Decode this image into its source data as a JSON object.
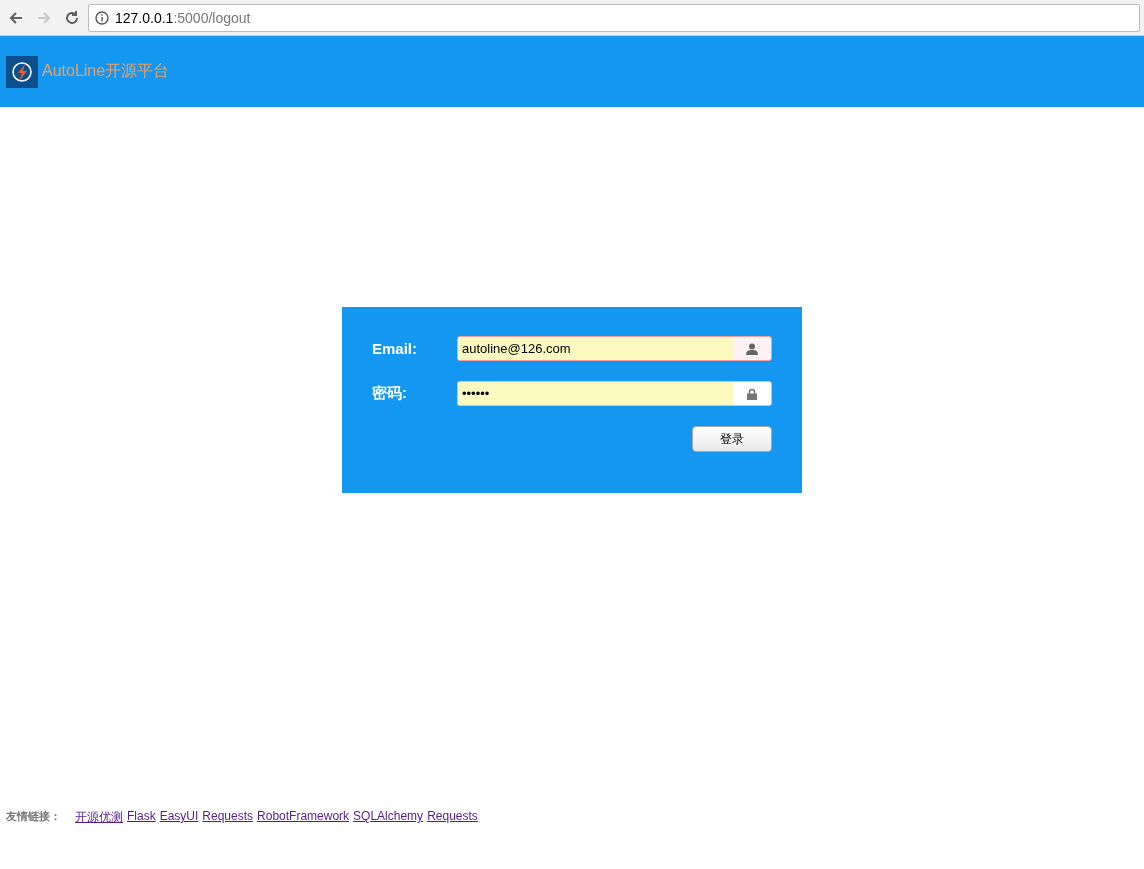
{
  "browser": {
    "nav_buttons": [
      {
        "kind": "back",
        "disabled": false
      },
      {
        "kind": "forward",
        "disabled": true
      },
      {
        "kind": "reload",
        "disabled": false
      }
    ],
    "url_host": "127.0.0.1",
    "url_rest": ":5000/logout"
  },
  "header": {
    "title": "AutoLine开源平台"
  },
  "login": {
    "fields": [
      {
        "label": "Email:",
        "value": "autoline@126.com",
        "kind": "email",
        "invalid": true
      },
      {
        "label": "密码:",
        "value": "••••••",
        "kind": "password",
        "invalid": false
      }
    ],
    "submit": "登录"
  },
  "footer": {
    "label": "友情链接：",
    "links": [
      "开源优测",
      "Flask",
      "EasyUI",
      "Requests",
      "RobotFramework",
      "SQLAlchemy",
      "Requests"
    ]
  }
}
